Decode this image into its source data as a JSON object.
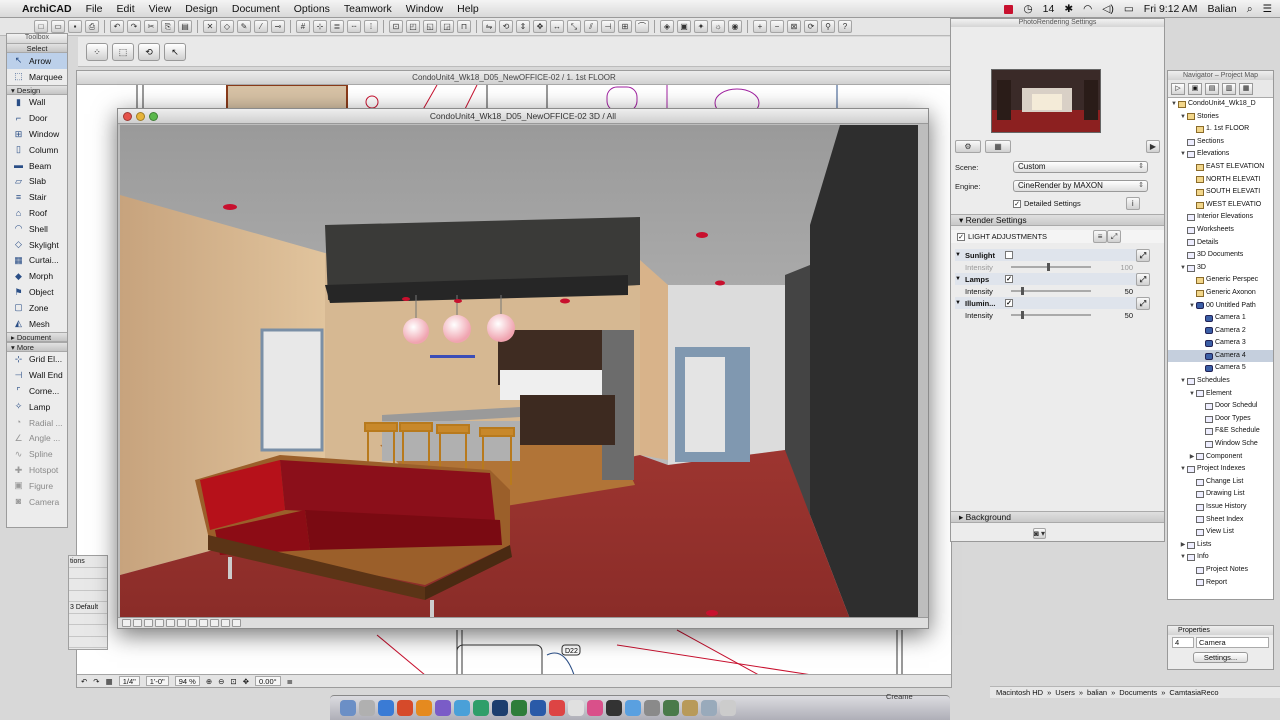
{
  "menubar": {
    "app": "ArchiCAD",
    "menus": [
      "File",
      "Edit",
      "View",
      "Design",
      "Document",
      "Options",
      "Teamwork",
      "Window",
      "Help"
    ],
    "status_num": "14",
    "clock": "Fri 9:12 AM",
    "user": "Balian"
  },
  "toolbox": {
    "title": "Toolbox",
    "select": "Select",
    "sections": {
      "design": "Design",
      "document": "Document",
      "more": "More"
    },
    "select_tools": [
      {
        "label": "Arrow",
        "icon": "arrow-icon"
      },
      {
        "label": "Marquee",
        "icon": "marquee-icon"
      }
    ],
    "design_tools": [
      {
        "label": "Wall",
        "icon": "wall-icon"
      },
      {
        "label": "Door",
        "icon": "door-icon"
      },
      {
        "label": "Window",
        "icon": "window-icon"
      },
      {
        "label": "Column",
        "icon": "column-icon"
      },
      {
        "label": "Beam",
        "icon": "beam-icon"
      },
      {
        "label": "Slab",
        "icon": "slab-icon"
      },
      {
        "label": "Stair",
        "icon": "stair-icon"
      },
      {
        "label": "Roof",
        "icon": "roof-icon"
      },
      {
        "label": "Shell",
        "icon": "shell-icon"
      },
      {
        "label": "Skylight",
        "icon": "skylight-icon"
      },
      {
        "label": "Curtai...",
        "icon": "curtain-wall-icon"
      },
      {
        "label": "Morph",
        "icon": "morph-icon"
      },
      {
        "label": "Object",
        "icon": "object-icon"
      },
      {
        "label": "Zone",
        "icon": "zone-icon"
      },
      {
        "label": "Mesh",
        "icon": "mesh-icon"
      }
    ],
    "more_tools": [
      {
        "label": "Grid El...",
        "icon": "grid-element-icon",
        "dim": false
      },
      {
        "label": "Wall End",
        "icon": "wall-end-icon",
        "dim": false
      },
      {
        "label": "Corne...",
        "icon": "corner-window-icon",
        "dim": false
      },
      {
        "label": "Lamp",
        "icon": "lamp-icon",
        "dim": false
      },
      {
        "label": "Radial ...",
        "icon": "radial-dimension-icon",
        "dim": true
      },
      {
        "label": "Angle ...",
        "icon": "angle-dimension-icon",
        "dim": true
      },
      {
        "label": "Spline",
        "icon": "spline-icon",
        "dim": true
      },
      {
        "label": "Hotspot",
        "icon": "hotspot-icon",
        "dim": true
      },
      {
        "label": "Figure",
        "icon": "figure-icon",
        "dim": true
      },
      {
        "label": "Camera",
        "icon": "camera-icon",
        "dim": true
      }
    ]
  },
  "infostub": [
    "tions",
    "",
    "",
    "",
    "3 Default",
    "",
    "",
    ""
  ],
  "planwin": {
    "title": "CondoUnit4_Wk18_D05_NewOFFICE-02 / 1. 1st FLOOR",
    "scale": "1/4\"",
    "scale2": "1'-0\"",
    "zoom": "94 %",
    "angle": "0.00°",
    "tag": "D22"
  },
  "win3d": {
    "title": "CondoUnit4_Wk18_D05_NewOFFICE-02 3D / All"
  },
  "photopal": {
    "title": "PhotoRendering Settings",
    "scene_label": "Scene:",
    "scene_value": "Custom",
    "engine_label": "Engine:",
    "engine_value": "CineRender by MAXON",
    "detailed": "Detailed Settings",
    "render_settings": "Render Settings",
    "light_adj": "LIGHT ADJUSTMENTS",
    "background": "Background",
    "rows": [
      {
        "head": "Sunlight",
        "checked": false,
        "label": "Intensity",
        "value": "100",
        "slider": 0.45
      },
      {
        "head": "Lamps",
        "checked": true,
        "label": "Intensity",
        "value": "50",
        "slider": 0.12
      },
      {
        "head": "Illumin...",
        "checked": true,
        "label": "Intensity",
        "value": "50",
        "slider": 0.12
      }
    ]
  },
  "navigator": {
    "title": "Navigator – Project Map",
    "items": [
      {
        "label": "CondoUnit4_Wk18_D",
        "depth": 0,
        "tri": "▼",
        "icon": "folder"
      },
      {
        "label": "Stories",
        "depth": 1,
        "tri": "▼",
        "icon": "folder"
      },
      {
        "label": "1. 1st FLOOR",
        "depth": 2,
        "tri": "",
        "icon": "folder"
      },
      {
        "label": "Sections",
        "depth": 1,
        "tri": "",
        "icon": "doc"
      },
      {
        "label": "Elevations",
        "depth": 1,
        "tri": "▼",
        "icon": "doc"
      },
      {
        "label": "EAST ELEVATION",
        "depth": 2,
        "tri": "",
        "icon": "folder"
      },
      {
        "label": "NORTH ELEVATI",
        "depth": 2,
        "tri": "",
        "icon": "folder"
      },
      {
        "label": "SOUTH ELEVATI",
        "depth": 2,
        "tri": "",
        "icon": "folder"
      },
      {
        "label": "WEST ELEVATIO",
        "depth": 2,
        "tri": "",
        "icon": "folder"
      },
      {
        "label": "Interior Elevations",
        "depth": 1,
        "tri": "",
        "icon": "doc"
      },
      {
        "label": "Worksheets",
        "depth": 1,
        "tri": "",
        "icon": "doc"
      },
      {
        "label": "Details",
        "depth": 1,
        "tri": "",
        "icon": "doc"
      },
      {
        "label": "3D Documents",
        "depth": 1,
        "tri": "",
        "icon": "doc"
      },
      {
        "label": "3D",
        "depth": 1,
        "tri": "▼",
        "icon": "doc"
      },
      {
        "label": "Generic Perspec",
        "depth": 2,
        "tri": "",
        "icon": "folder"
      },
      {
        "label": "Generic Axonon",
        "depth": 2,
        "tri": "",
        "icon": "folder"
      },
      {
        "label": "00 Untitled Path",
        "depth": 2,
        "tri": "▼",
        "icon": "cam"
      },
      {
        "label": "Camera 1",
        "depth": 3,
        "tri": "",
        "icon": "cam"
      },
      {
        "label": "Camera 2",
        "depth": 3,
        "tri": "",
        "icon": "cam"
      },
      {
        "label": "Camera 3",
        "depth": 3,
        "tri": "",
        "icon": "cam"
      },
      {
        "label": "Camera 4",
        "depth": 3,
        "tri": "",
        "icon": "cam",
        "sel": true
      },
      {
        "label": "Camera 5",
        "depth": 3,
        "tri": "",
        "icon": "cam"
      },
      {
        "label": "Schedules",
        "depth": 1,
        "tri": "▼",
        "icon": "doc"
      },
      {
        "label": "Element",
        "depth": 2,
        "tri": "▼",
        "icon": "doc"
      },
      {
        "label": "Door Schedul",
        "depth": 3,
        "tri": "",
        "icon": "doc"
      },
      {
        "label": "Door Types",
        "depth": 3,
        "tri": "",
        "icon": "doc"
      },
      {
        "label": "F&E Schedule",
        "depth": 3,
        "tri": "",
        "icon": "doc"
      },
      {
        "label": "Window Sche",
        "depth": 3,
        "tri": "",
        "icon": "doc"
      },
      {
        "label": "Component",
        "depth": 2,
        "tri": "▶",
        "icon": "doc"
      },
      {
        "label": "Project Indexes",
        "depth": 1,
        "tri": "▼",
        "icon": "doc"
      },
      {
        "label": "Change List",
        "depth": 2,
        "tri": "",
        "icon": "doc"
      },
      {
        "label": "Drawing List",
        "depth": 2,
        "tri": "",
        "icon": "doc"
      },
      {
        "label": "Issue History",
        "depth": 2,
        "tri": "",
        "icon": "doc"
      },
      {
        "label": "Sheet Index",
        "depth": 2,
        "tri": "",
        "icon": "doc"
      },
      {
        "label": "View List",
        "depth": 2,
        "tri": "",
        "icon": "doc"
      },
      {
        "label": "Lists",
        "depth": 1,
        "tri": "▶",
        "icon": "doc"
      },
      {
        "label": "Info",
        "depth": 1,
        "tri": "▼",
        "icon": "doc"
      },
      {
        "label": "Project Notes",
        "depth": 2,
        "tri": "",
        "icon": "doc"
      },
      {
        "label": "Report",
        "depth": 2,
        "tri": "",
        "icon": "doc"
      }
    ]
  },
  "props": {
    "title": "Properties",
    "id": "4",
    "name": "Camera",
    "settings": "Settings..."
  },
  "pathbar": [
    "Macintosh HD",
    "Users",
    "balian",
    "Documents",
    "CamtasiaReco"
  ],
  "dock_label": "Creame"
}
